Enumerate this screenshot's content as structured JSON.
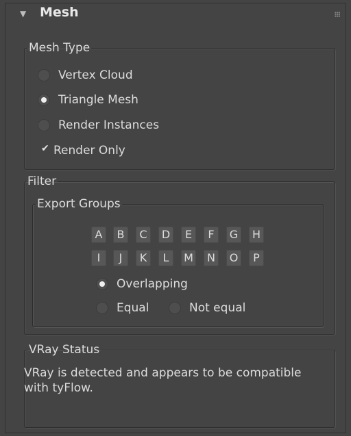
{
  "rollout": {
    "title": "Mesh"
  },
  "mesh_type": {
    "legend": "Mesh Type",
    "options": [
      {
        "label": "Vertex Cloud",
        "checked": false
      },
      {
        "label": "Triangle Mesh",
        "checked": true
      },
      {
        "label": "Render Instances",
        "checked": false
      }
    ],
    "render_only": {
      "label": "Render Only",
      "checked": true
    }
  },
  "filter": {
    "legend": "Filter",
    "export_groups": {
      "legend": "Export Groups",
      "row1": [
        "A",
        "B",
        "C",
        "D",
        "E",
        "F",
        "G",
        "H"
      ],
      "row2": [
        "I",
        "J",
        "K",
        "L",
        "M",
        "N",
        "O",
        "P"
      ],
      "modes": [
        {
          "label": "Overlapping",
          "checked": true
        },
        {
          "label": "Equal",
          "checked": false
        },
        {
          "label": "Not equal",
          "checked": false
        }
      ]
    }
  },
  "vray_status": {
    "legend": "VRay Status",
    "text": "VRay is detected and appears to be compatible with tyFlow."
  }
}
